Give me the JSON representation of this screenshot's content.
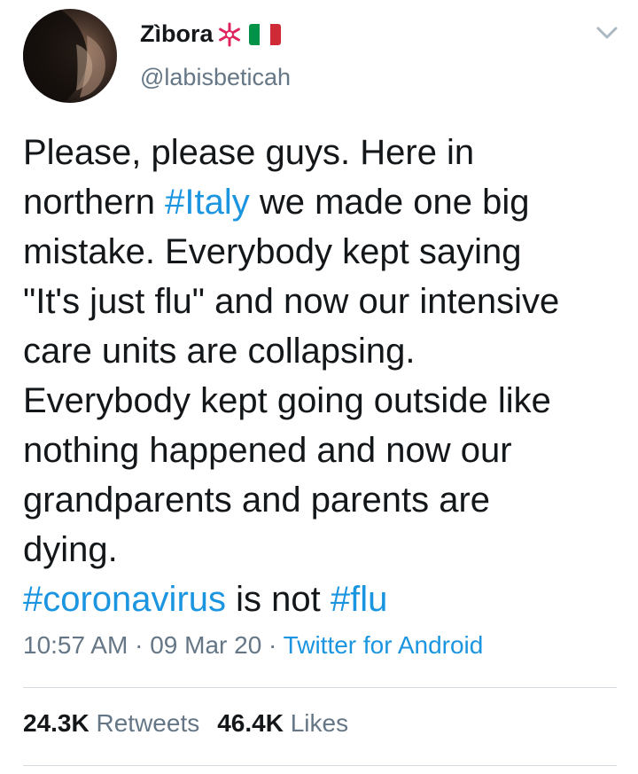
{
  "user": {
    "display_name": "Zìbora",
    "handle": "@labisbeticah",
    "badge_icon": "red-snowflake-badge-icon",
    "flag_icon": "italy-flag-icon",
    "flag_colors": [
      "#009246",
      "#ffffff",
      "#ce2b37"
    ]
  },
  "tweet": {
    "lines": [
      [
        {
          "t": "Please, please guys. Here in"
        }
      ],
      [
        {
          "t": "northern "
        },
        {
          "t": "#Italy",
          "tag": true
        },
        {
          "t": " we made one big"
        }
      ],
      [
        {
          "t": "mistake. Everybody kept saying"
        }
      ],
      [
        {
          "t": "\"It's just flu\" and now our intensive"
        }
      ],
      [
        {
          "t": "care units are collapsing."
        }
      ],
      [
        {
          "t": "Everybody kept going outside like"
        }
      ],
      [
        {
          "t": "nothing happened and now our"
        }
      ],
      [
        {
          "t": "grandparents and parents are"
        }
      ],
      [
        {
          "t": "dying."
        }
      ],
      [
        {
          "t": "#coronavirus",
          "tag": true
        },
        {
          "t": " is not "
        },
        {
          "t": "#flu",
          "tag": true
        }
      ]
    ]
  },
  "meta": {
    "time": "10:57 AM",
    "sep1": " · ",
    "date": "09 Mar 20",
    "sep2": " · ",
    "source": "Twitter for Android"
  },
  "stats": {
    "retweets_count": "24.3K",
    "retweets_label": "Retweets",
    "likes_count": "46.4K",
    "likes_label": "Likes"
  },
  "colors": {
    "link": "#1b95e0",
    "secondary": "#657786",
    "text": "#14171a",
    "divider": "#d6dbe0"
  }
}
